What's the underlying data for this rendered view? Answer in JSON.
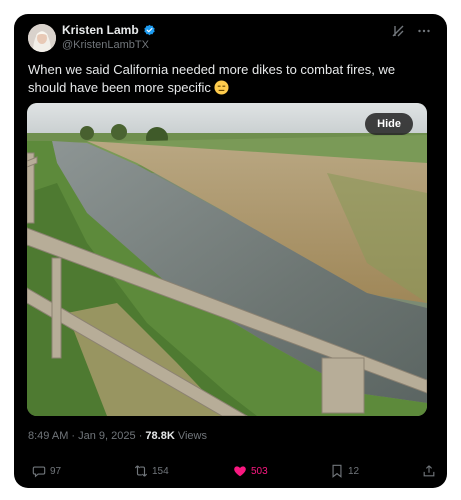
{
  "author": {
    "name": "Kristen Lamb",
    "handle": "@KristenLambTX",
    "verified_color": "#1d9bf0"
  },
  "tweet": {
    "text": "When we said California needed more dikes to combat fires, we should have been more specific",
    "emoji_icon": "expressionless-face-emoji"
  },
  "media": {
    "hide_label": "Hide"
  },
  "meta": {
    "time": "8:49 AM",
    "sep1": " · ",
    "date": "Jan 9, 2025",
    "sep2": " · ",
    "views_count": "78.8K",
    "views_label": " Views"
  },
  "actions": {
    "replies": "97",
    "reposts": "154",
    "likes": "503",
    "bookmarks": "12",
    "like_color": "#f91880"
  }
}
